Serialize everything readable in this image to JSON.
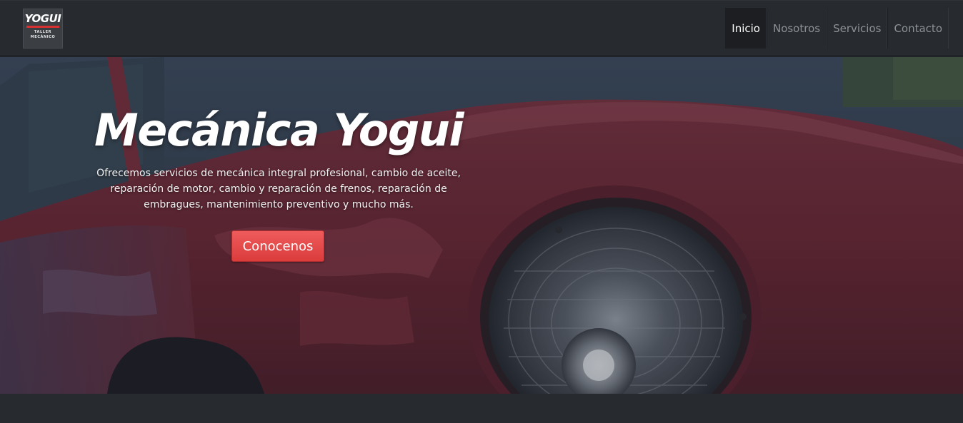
{
  "brand": {
    "logo_word": "YOGUI",
    "logo_sub_line1": "TALLER",
    "logo_sub_line2": "MECÁNICO",
    "accent_color": "#d83131"
  },
  "nav": {
    "items": [
      {
        "label": "Inicio",
        "active": true
      },
      {
        "label": "Nosotros",
        "active": false
      },
      {
        "label": "Servicios",
        "active": false
      },
      {
        "label": "Contacto",
        "active": false
      }
    ]
  },
  "hero": {
    "title": "Mecánica Yogui",
    "description": "Ofrecemos servicios de mecánica integral profesional, cambio de aceite, reparación de motor, cambio y reparación de frenos, reparación de embragues, mantenimiento preventivo y mucho más.",
    "button_label": "Conocenos",
    "button_color": "#e24848",
    "background_icon": "red-car-photo"
  }
}
